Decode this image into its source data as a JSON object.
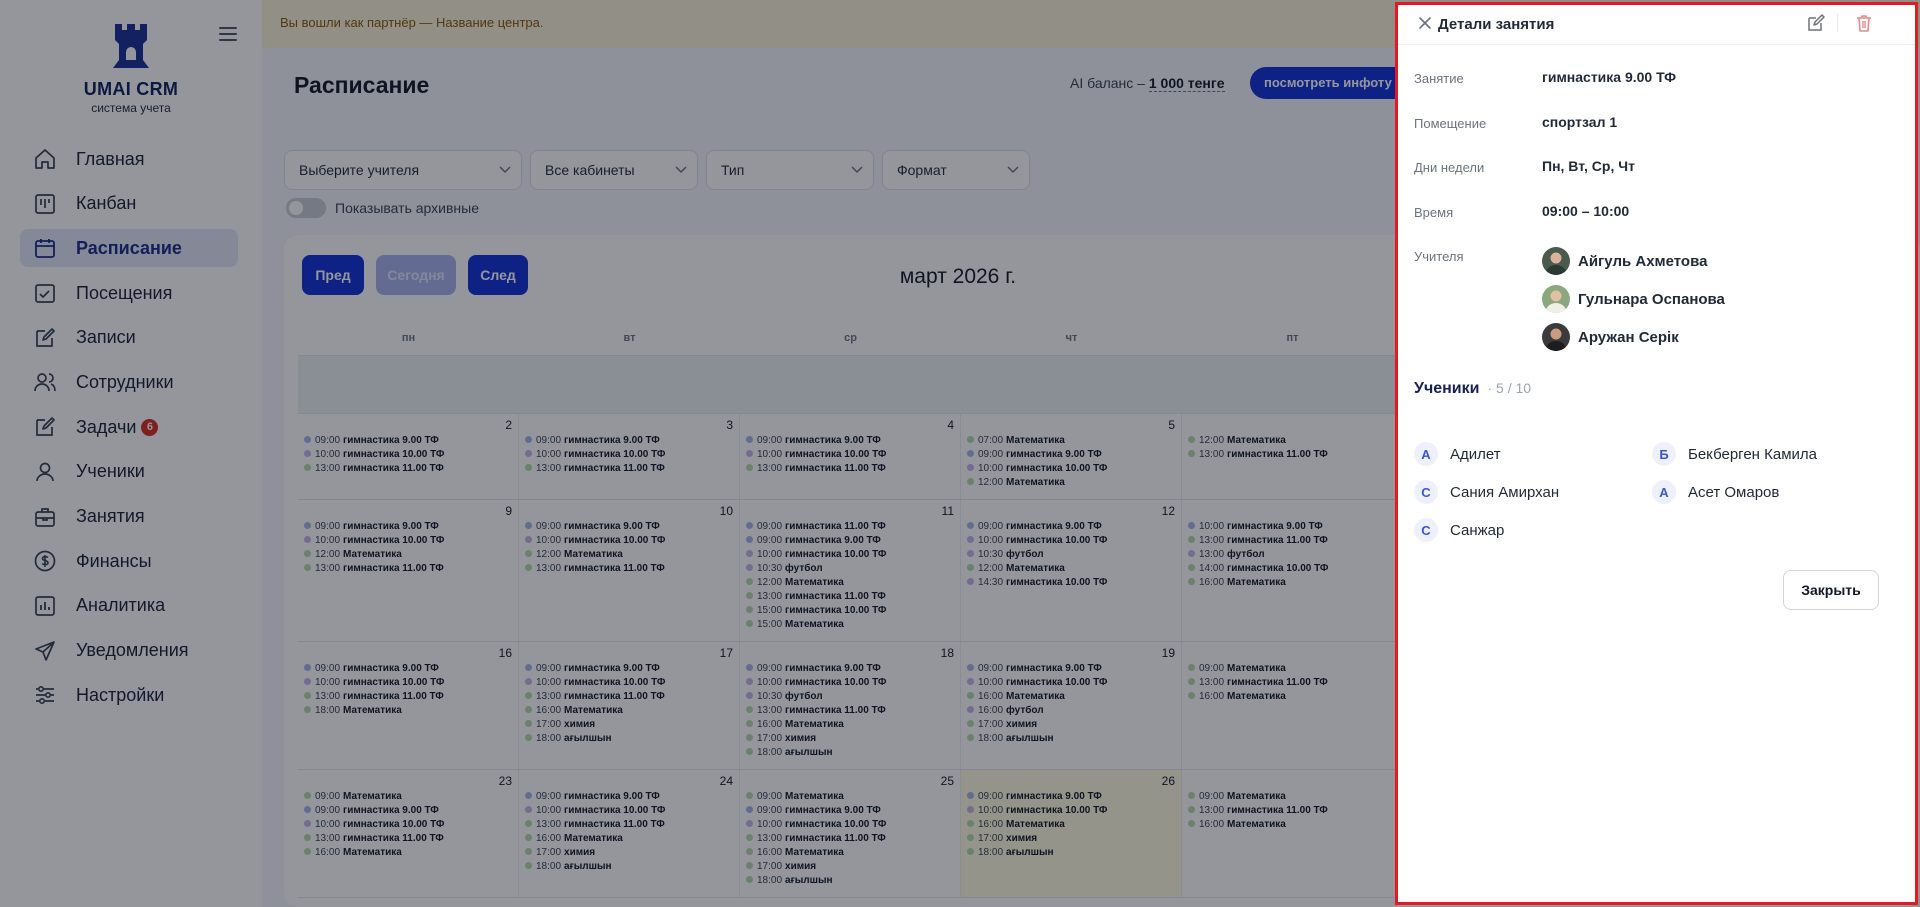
{
  "brand": {
    "name": "UMAI CRM",
    "subtitle": "система учета"
  },
  "sidebar": {
    "items": [
      {
        "label": "Главная",
        "icon": "home-icon"
      },
      {
        "label": "Канбан",
        "icon": "kanban-icon"
      },
      {
        "label": "Расписание",
        "icon": "calendar-icon",
        "active": true
      },
      {
        "label": "Посещения",
        "icon": "attendance-icon"
      },
      {
        "label": "Записи",
        "icon": "edit-note-icon"
      },
      {
        "label": "Сотрудники",
        "icon": "staff-icon"
      },
      {
        "label": "Задачи",
        "icon": "tasks-icon",
        "badge": "6"
      },
      {
        "label": "Ученики",
        "icon": "student-icon"
      },
      {
        "label": "Занятия",
        "icon": "briefcase-icon"
      },
      {
        "label": "Финансы",
        "icon": "dollar-icon"
      },
      {
        "label": "Аналитика",
        "icon": "chart-icon"
      },
      {
        "label": "Уведомления",
        "icon": "send-icon"
      },
      {
        "label": "Настройки",
        "icon": "sliders-icon"
      }
    ]
  },
  "header": {
    "partner_notice": "Вы вошли как партнёр — Название центра.",
    "page_title": "Расписание",
    "ai_balance_label": "AI баланс –",
    "ai_balance_value": "1 000 тенге",
    "info_button": "посмотреть инфоту"
  },
  "filters": {
    "teacher": "Выберите учителя",
    "rooms": "Все кабинеты",
    "type": "Тип",
    "format": "Формат",
    "show_archived": "Показывать архивные"
  },
  "calendar": {
    "prev": "Пред",
    "today": "Сегодня",
    "next": "След",
    "title": "март 2026 г.",
    "weekdays": [
      "пн",
      "вт",
      "ср",
      "чт",
      "пт"
    ],
    "weeks": [
      {
        "days": [
          {
            "num": "2",
            "events": [
              [
                "09:00",
                "гимнастика 9.00 ТФ",
                "#a7b4e8"
              ],
              [
                "10:00",
                "гимнастика 10.00 ТФ",
                "#c8b2e8"
              ],
              [
                "13:00",
                "гимнастика 11.00 ТФ",
                "#b5dca8"
              ]
            ]
          },
          {
            "num": "3",
            "events": [
              [
                "09:00",
                "гимнастика 9.00 ТФ",
                "#a7b4e8"
              ],
              [
                "10:00",
                "гимнастика 10.00 ТФ",
                "#c8b2e8"
              ],
              [
                "13:00",
                "гимнастика 11.00 ТФ",
                "#b5dca8"
              ]
            ]
          },
          {
            "num": "4",
            "events": [
              [
                "09:00",
                "гимнастика 9.00 ТФ",
                "#a7b4e8"
              ],
              [
                "10:00",
                "гимнастика 10.00 ТФ",
                "#c8b2e8"
              ],
              [
                "13:00",
                "гимнастика 11.00 ТФ",
                "#b5dca8"
              ]
            ]
          },
          {
            "num": "5",
            "events": [
              [
                "07:00",
                "Математика",
                "#b5dca8"
              ],
              [
                "09:00",
                "гимнастика 9.00 ТФ",
                "#a7b4e8"
              ],
              [
                "10:00",
                "гимнастика 10.00 ТФ",
                "#c8b2e8"
              ],
              [
                "12:00",
                "Математика",
                "#b5dca8"
              ]
            ]
          },
          {
            "num": "",
            "events": [
              [
                "12:00",
                "Математика",
                "#b5dca8"
              ],
              [
                "13:00",
                "гимнастика 11.00 ТФ",
                "#b5dca8"
              ]
            ]
          }
        ]
      },
      {
        "days": [
          {
            "num": "9",
            "events": [
              [
                "09:00",
                "гимнастика 9.00 ТФ",
                "#a7b4e8"
              ],
              [
                "10:00",
                "гимнастика 10.00 ТФ",
                "#c8b2e8"
              ],
              [
                "12:00",
                "Математика",
                "#b5dca8"
              ],
              [
                "13:00",
                "гимнастика 11.00 ТФ",
                "#b5dca8"
              ]
            ]
          },
          {
            "num": "10",
            "events": [
              [
                "09:00",
                "гимнастика 9.00 ТФ",
                "#a7b4e8"
              ],
              [
                "10:00",
                "гимнастика 10.00 ТФ",
                "#c8b2e8"
              ],
              [
                "12:00",
                "Математика",
                "#b5dca8"
              ],
              [
                "13:00",
                "гимнастика 11.00 ТФ",
                "#b5dca8"
              ]
            ]
          },
          {
            "num": "11",
            "events": [
              [
                "09:00",
                "гимнастика 11.00 ТФ",
                "#a7b4e8"
              ],
              [
                "09:00",
                "гимнастика 9.00 ТФ",
                "#a7b4e8"
              ],
              [
                "10:00",
                "гимнастика 10.00 ТФ",
                "#c8b2e8"
              ],
              [
                "10:30",
                "футбол",
                "#c8b2e8"
              ],
              [
                "12:00",
                "Математика",
                "#b5dca8"
              ],
              [
                "13:00",
                "гимнастика 11.00 ТФ",
                "#b5dca8"
              ],
              [
                "15:00",
                "гимнастика 10.00 ТФ",
                "#b5dca8"
              ],
              [
                "15:00",
                "Математика",
                "#b5dca8"
              ]
            ]
          },
          {
            "num": "12",
            "events": [
              [
                "09:00",
                "гимнастика 9.00 ТФ",
                "#a7b4e8"
              ],
              [
                "10:00",
                "гимнастика 10.00 ТФ",
                "#c8b2e8"
              ],
              [
                "10:30",
                "футбол",
                "#c8b2e8"
              ],
              [
                "12:00",
                "Математика",
                "#b5dca8"
              ],
              [
                "14:30",
                "гимнастика 10.00 ТФ",
                "#c8b2e8"
              ]
            ]
          },
          {
            "num": "",
            "events": [
              [
                "10:00",
                "гимнастика 9.00 ТФ",
                "#a7b4e8"
              ],
              [
                "13:00",
                "гимнастика 11.00 ТФ",
                "#b5dca8"
              ],
              [
                "13:00",
                "футбол",
                "#c8b2e8"
              ],
              [
                "14:00",
                "гимнастика 10.00 ТФ",
                "#b5dca8"
              ],
              [
                "16:00",
                "Математика",
                "#b5dca8"
              ]
            ]
          }
        ]
      },
      {
        "days": [
          {
            "num": "16",
            "events": [
              [
                "09:00",
                "гимнастика 9.00 ТФ",
                "#a7b4e8"
              ],
              [
                "10:00",
                "гимнастика 10.00 ТФ",
                "#c8b2e8"
              ],
              [
                "13:00",
                "гимнастика 11.00 ТФ",
                "#b5dca8"
              ],
              [
                "18:00",
                "Математика",
                "#b5dca8"
              ]
            ]
          },
          {
            "num": "17",
            "events": [
              [
                "09:00",
                "гимнастика 9.00 ТФ",
                "#a7b4e8"
              ],
              [
                "10:00",
                "гимнастика 10.00 ТФ",
                "#c8b2e8"
              ],
              [
                "13:00",
                "гимнастика 11.00 ТФ",
                "#b5dca8"
              ],
              [
                "16:00",
                "Математика",
                "#b5dca8"
              ],
              [
                "17:00",
                "химия",
                "#b5dca8"
              ],
              [
                "18:00",
                "ағылшын",
                "#b5dca8"
              ]
            ]
          },
          {
            "num": "18",
            "events": [
              [
                "09:00",
                "гимнастика 9.00 ТФ",
                "#a7b4e8"
              ],
              [
                "10:00",
                "гимнастика 10.00 ТФ",
                "#c8b2e8"
              ],
              [
                "10:30",
                "футбол",
                "#c8b2e8"
              ],
              [
                "13:00",
                "гимнастика 11.00 ТФ",
                "#b5dca8"
              ],
              [
                "16:00",
                "Математика",
                "#b5dca8"
              ],
              [
                "17:00",
                "химия",
                "#b5dca8"
              ],
              [
                "18:00",
                "ағылшын",
                "#b5dca8"
              ]
            ]
          },
          {
            "num": "19",
            "events": [
              [
                "09:00",
                "гимнастика 9.00 ТФ",
                "#a7b4e8"
              ],
              [
                "10:00",
                "гимнастика 10.00 ТФ",
                "#c8b2e8"
              ],
              [
                "16:00",
                "Математика",
                "#b5dca8"
              ],
              [
                "16:00",
                "футбол",
                "#c8b2e8"
              ],
              [
                "17:00",
                "химия",
                "#b5dca8"
              ],
              [
                "18:00",
                "ағылшын",
                "#b5dca8"
              ]
            ]
          },
          {
            "num": "",
            "events": [
              [
                "09:00",
                "Математика",
                "#b5dca8"
              ],
              [
                "13:00",
                "гимнастика 11.00 ТФ",
                "#b5dca8"
              ],
              [
                "16:00",
                "Математика",
                "#b5dca8"
              ]
            ]
          }
        ]
      },
      {
        "days": [
          {
            "num": "23",
            "events": [
              [
                "09:00",
                "Математика",
                "#b5dca8"
              ],
              [
                "09:00",
                "гимнастика 9.00 ТФ",
                "#a7b4e8"
              ],
              [
                "10:00",
                "гимнастика 10.00 ТФ",
                "#c8b2e8"
              ],
              [
                "13:00",
                "гимнастика 11.00 ТФ",
                "#b5dca8"
              ],
              [
                "16:00",
                "Математика",
                "#b5dca8"
              ]
            ]
          },
          {
            "num": "24",
            "events": [
              [
                "09:00",
                "гимнастика 9.00 ТФ",
                "#a7b4e8"
              ],
              [
                "10:00",
                "гимнастика 10.00 ТФ",
                "#c8b2e8"
              ],
              [
                "13:00",
                "гимнастика 11.00 ТФ",
                "#b5dca8"
              ],
              [
                "16:00",
                "Математика",
                "#b5dca8"
              ],
              [
                "17:00",
                "химия",
                "#b5dca8"
              ],
              [
                "18:00",
                "ағылшын",
                "#b5dca8"
              ]
            ]
          },
          {
            "num": "25",
            "events": [
              [
                "09:00",
                "Математика",
                "#b5dca8"
              ],
              [
                "09:00",
                "гимнастика 9.00 ТФ",
                "#a7b4e8"
              ],
              [
                "10:00",
                "гимнастика 10.00 ТФ",
                "#c8b2e8"
              ],
              [
                "13:00",
                "гимнастика 11.00 ТФ",
                "#b5dca8"
              ],
              [
                "16:00",
                "Математика",
                "#b5dca8"
              ],
              [
                "17:00",
                "химия",
                "#b5dca8"
              ],
              [
                "18:00",
                "ағылшын",
                "#b5dca8"
              ]
            ]
          },
          {
            "num": "26",
            "today": true,
            "events": [
              [
                "09:00",
                "гимнастика 9.00 ТФ",
                "#a7b4e8"
              ],
              [
                "10:00",
                "гимнастика 10.00 ТФ",
                "#c8b2e8"
              ],
              [
                "16:00",
                "Математика",
                "#b5dca8"
              ],
              [
                "17:00",
                "химия",
                "#b5dca8"
              ],
              [
                "18:00",
                "ағылшын",
                "#b5dca8"
              ]
            ]
          },
          {
            "num": "",
            "events": [
              [
                "09:00",
                "Математика",
                "#b5dca8"
              ],
              [
                "13:00",
                "гимнастика 11.00 ТФ",
                "#b5dca8"
              ],
              [
                "16:00",
                "Математика",
                "#b5dca8"
              ]
            ]
          }
        ]
      }
    ]
  },
  "drawer": {
    "title": "Детали занятия",
    "fields": [
      {
        "label": "Занятие",
        "value": "гимнастика 9.00 ТФ"
      },
      {
        "label": "Помещение",
        "value": "спортзал 1"
      },
      {
        "label": "Дни недели",
        "value": "Пн, Вт, Ср, Чт"
      },
      {
        "label": "Время",
        "value": "09:00 – 10:00"
      }
    ],
    "teachers_label": "Учителя",
    "teachers": [
      "Айгуль Ахметова",
      "Гульнара Оспанова",
      "Аружан Серік"
    ],
    "students_label": "Ученики",
    "students_count": "· 5 / 10",
    "students": [
      {
        "initial": "А",
        "name": "Адилет"
      },
      {
        "initial": "Б",
        "name": "Бекберген Камила"
      },
      {
        "initial": "С",
        "name": "Сания Амирхан"
      },
      {
        "initial": "А",
        "name": "Асет Омаров"
      },
      {
        "initial": "С",
        "name": "Санжар"
      }
    ],
    "close_button": "Закрыть"
  }
}
